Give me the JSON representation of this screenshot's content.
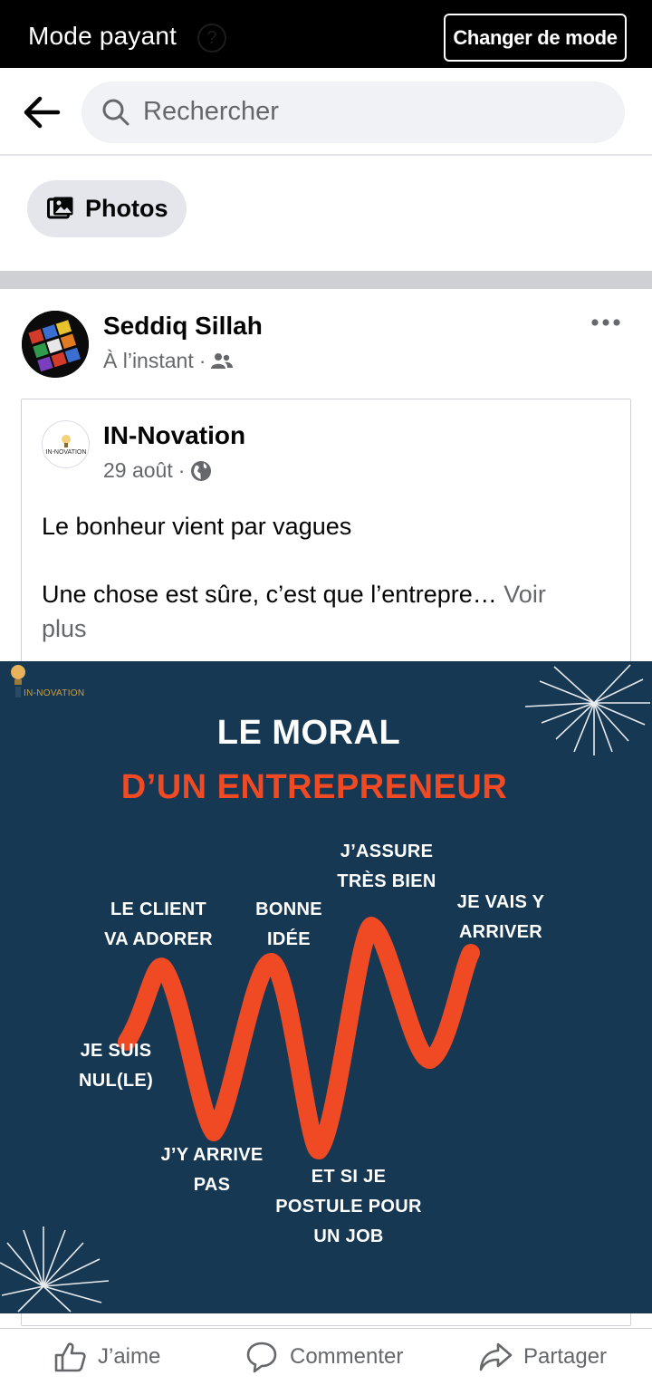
{
  "mode_bar": {
    "title": "Mode payant",
    "button_label": "Changer de mode",
    "help_symbol": "?"
  },
  "search": {
    "placeholder": "Rechercher"
  },
  "filters": [
    {
      "label": "Photos",
      "icon": "photos-icon"
    }
  ],
  "post": {
    "author": "Seddiq Sillah",
    "time": "À l’instant",
    "separator": "·",
    "audience_icon": "friends-icon",
    "shared": {
      "page_name": "IN-Novation",
      "date": "29 août",
      "separator": "·",
      "audience_icon": "globe-icon",
      "text_line_1": "Le bonheur vient par vagues",
      "text_line_2": "Une chose est sûre, c’est que l’entrepre…",
      "see_more": "Voir",
      "see_more_2": "plus"
    },
    "image": {
      "logo_text": "IN-NOVATION",
      "title_line_1": "LE MORAL",
      "title_line_2": "D’UN ENTREPRENEUR",
      "labels": {
        "client_1": "LE CLIENT",
        "client_2": "VA ADORER",
        "idee_1": "BONNE",
        "idee_2": "IDÉE",
        "assure_1": "J’ASSURE",
        "assure_2": "TRÈS BIEN",
        "arriver_1": "JE VAIS Y",
        "arriver_2": "ARRIVER",
        "nul_1": "JE SUIS",
        "nul_2": "NUL(LE)",
        "pas_1": "J’Y ARRIVE",
        "pas_2": "PAS",
        "job_1": "ET SI JE",
        "job_2": "POSTULE POUR",
        "job_3": "UN JOB"
      },
      "colors": {
        "background": "#163853",
        "accent": "#f04a24",
        "text": "#ffffff"
      }
    }
  },
  "actions": {
    "like": "J’aime",
    "comment": "Commenter",
    "share": "Partager"
  }
}
